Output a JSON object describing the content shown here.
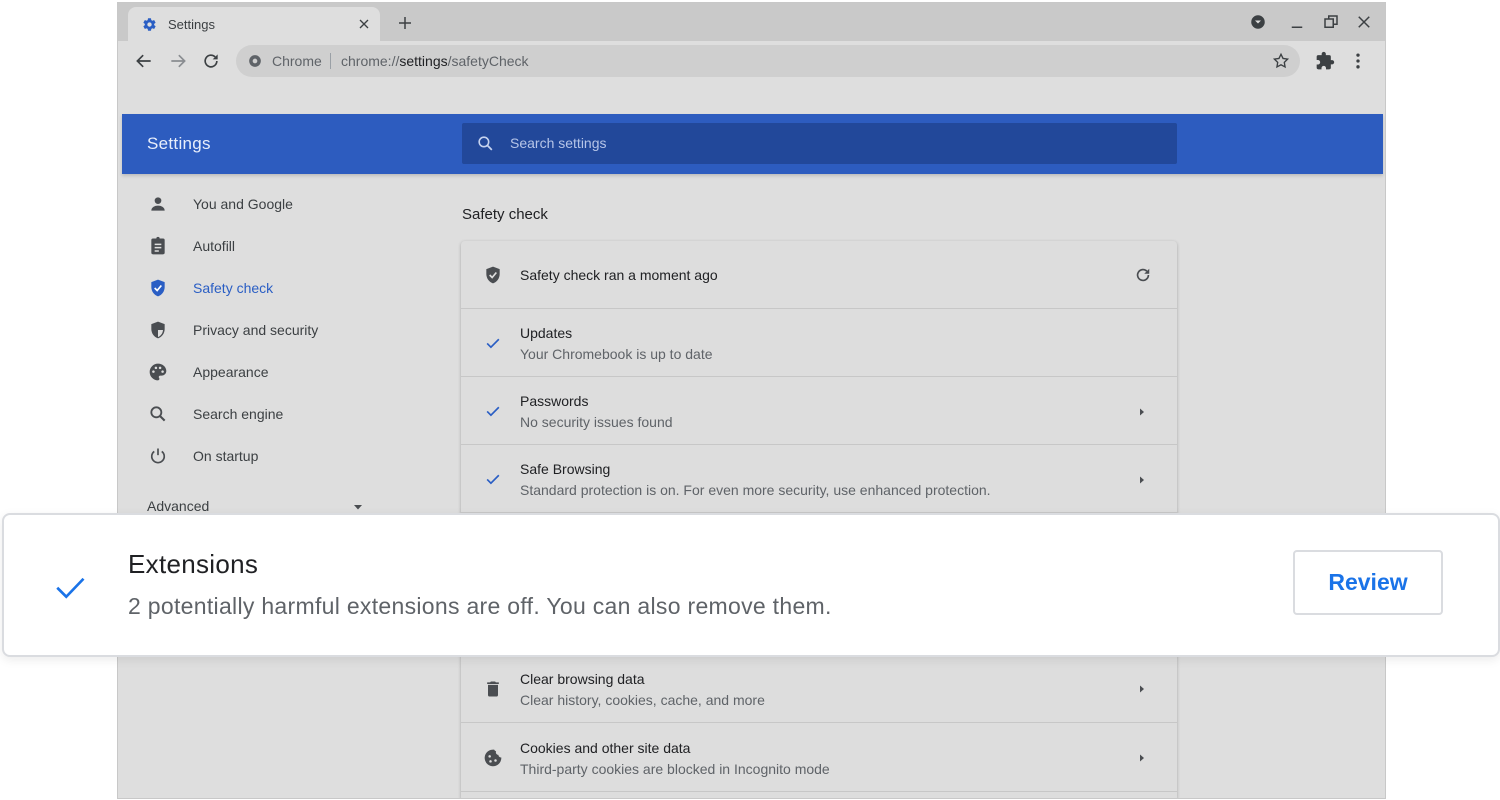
{
  "browser": {
    "tab_title": "Settings",
    "omnibox_chip": "Chrome",
    "url_scheme": "chrome://",
    "url_host": "settings",
    "url_path": "/safetyCheck"
  },
  "settings": {
    "heading": "Settings",
    "search_placeholder": "Search settings",
    "accent_color": "#2d5cbf"
  },
  "sidebar": {
    "items": [
      {
        "label": "You and Google",
        "icon": "person-icon"
      },
      {
        "label": "Autofill",
        "icon": "clipboard-icon"
      },
      {
        "label": "Safety check",
        "icon": "shield-check-icon",
        "active": true
      },
      {
        "label": "Privacy and security",
        "icon": "shield-half-icon"
      },
      {
        "label": "Appearance",
        "icon": "palette-icon"
      },
      {
        "label": "Search engine",
        "icon": "search-icon"
      },
      {
        "label": "On startup",
        "icon": "power-icon"
      }
    ],
    "advanced": "Advanced"
  },
  "main": {
    "title": "Safety check",
    "status": "Safety check ran a moment ago",
    "rows": [
      {
        "title": "Updates",
        "subtitle": "Your Chromebook is up to date"
      },
      {
        "title": "Passwords",
        "subtitle": "No security issues found"
      },
      {
        "title": "Safe Browsing",
        "subtitle": "Standard protection is on. For even more security, use enhanced protection."
      },
      {
        "title": "Clear browsing data",
        "subtitle": "Clear history, cookies, cache, and more"
      },
      {
        "title": "Cookies and other site data",
        "subtitle": "Third-party cookies are blocked in Incognito mode"
      }
    ]
  },
  "callout": {
    "title": "Extensions",
    "subtitle": "2 potentially harmful extensions are off. You can also remove them.",
    "button": "Review"
  }
}
